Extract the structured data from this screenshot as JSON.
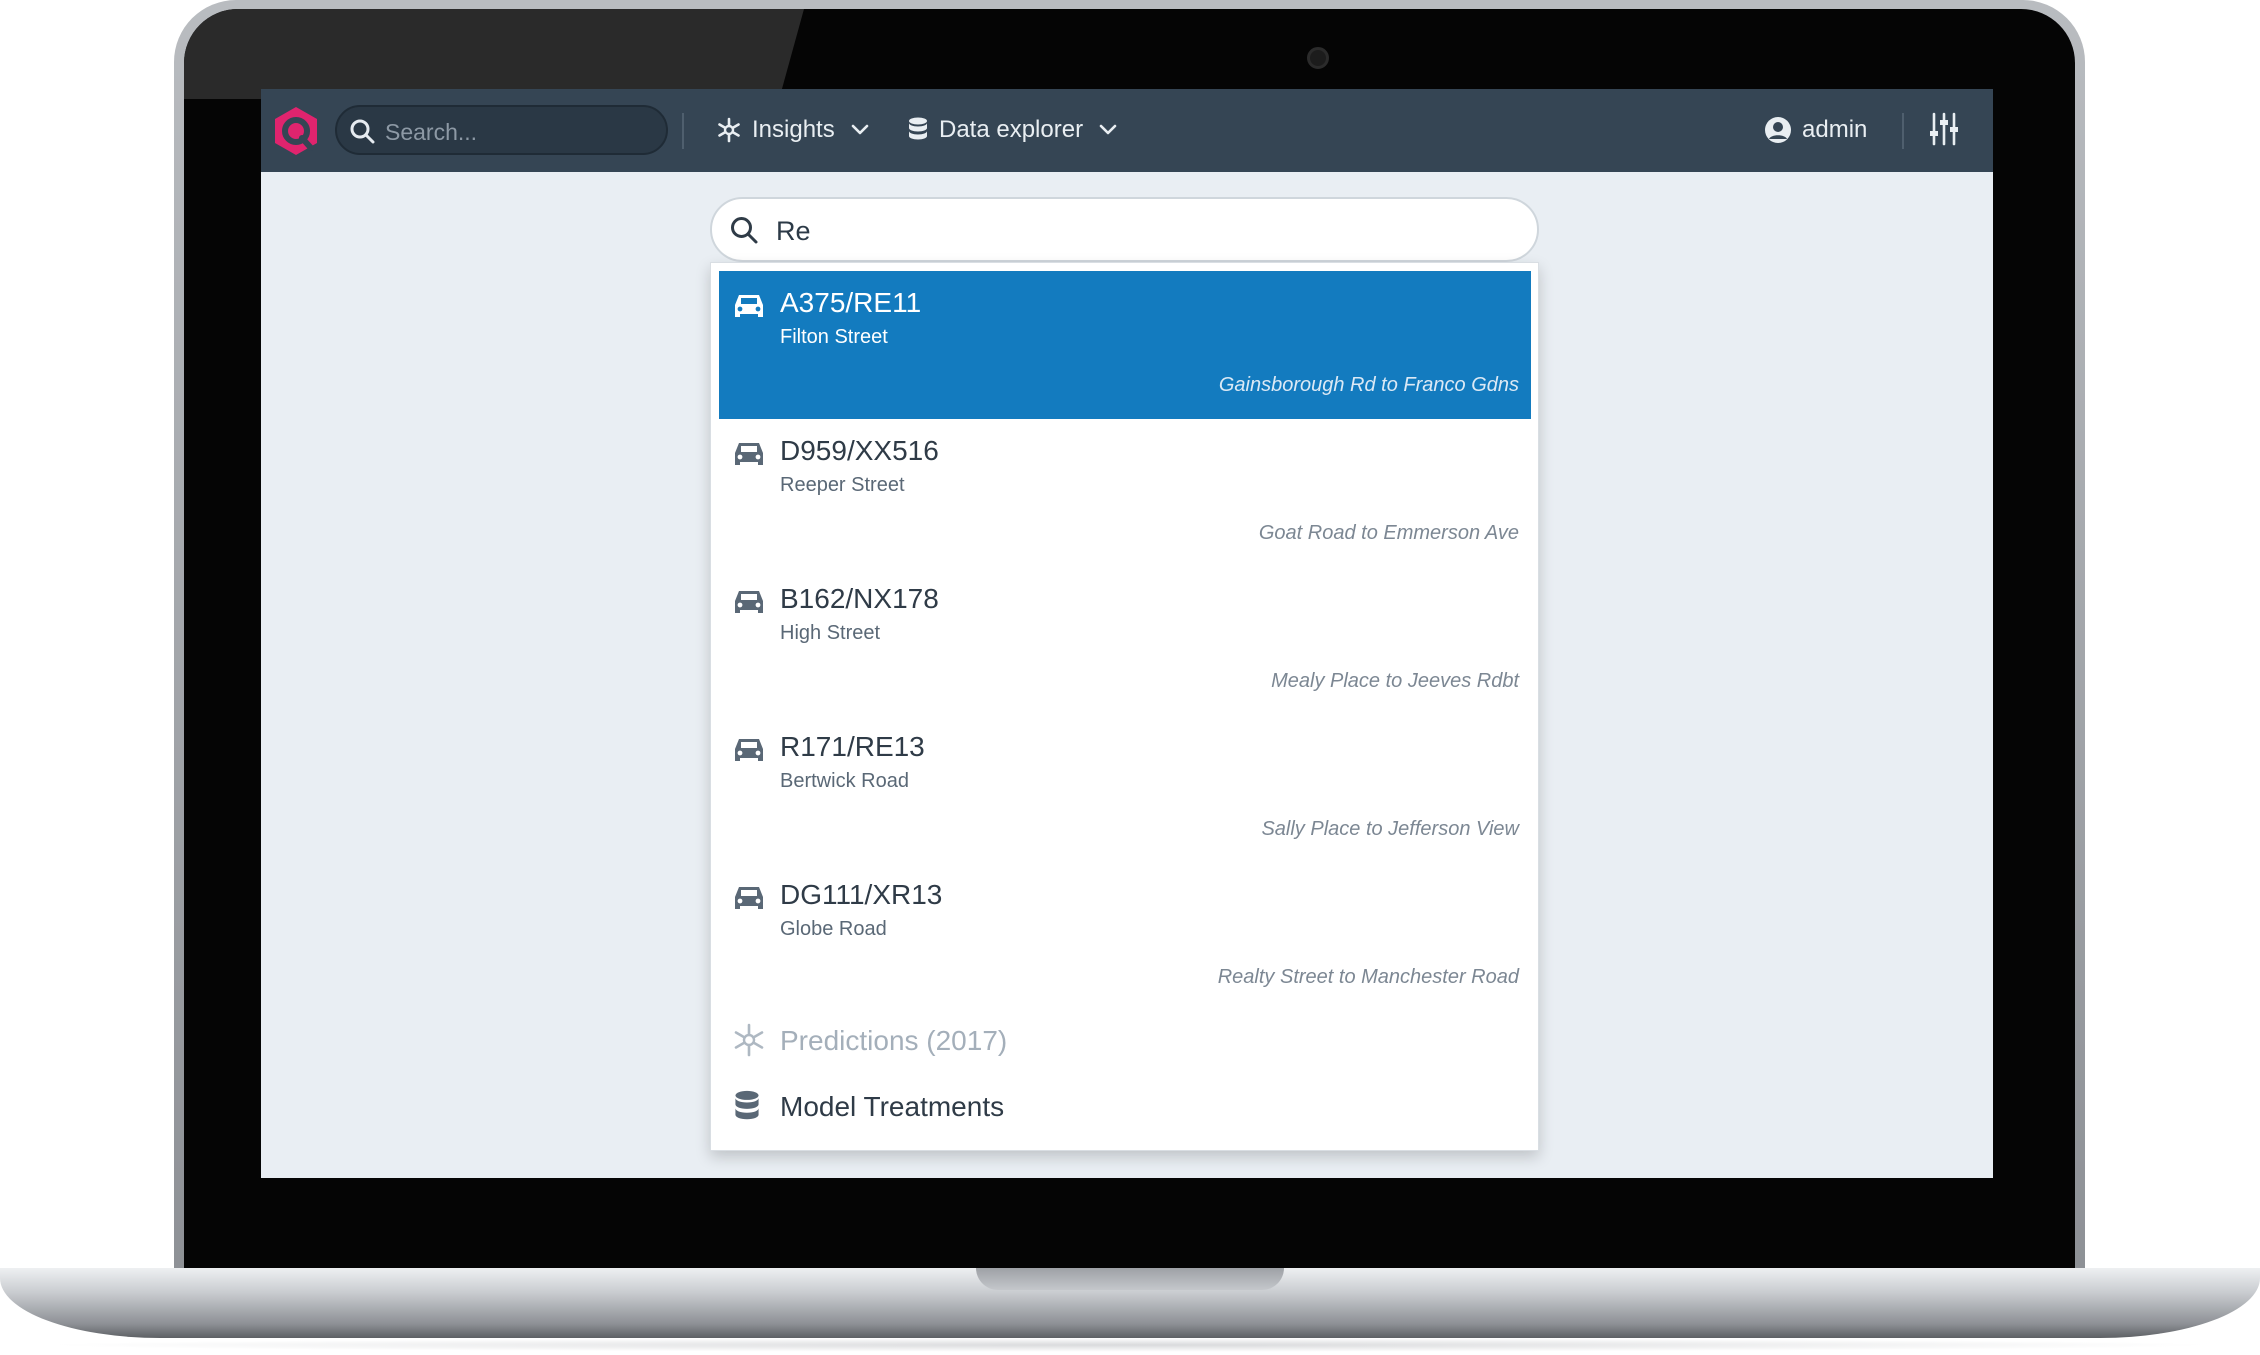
{
  "topbar": {
    "search_placeholder": "Search...",
    "nav": [
      {
        "label": "Insights",
        "icon": "asterisk-icon"
      },
      {
        "label": "Data explorer",
        "icon": "database-icon"
      }
    ],
    "user": "admin"
  },
  "search": {
    "value": "Re"
  },
  "results": [
    {
      "code": "A375/RE11",
      "street": "Filton Street",
      "range": "Gainsborough Rd to Franco Gdns",
      "active": true
    },
    {
      "code": "D959/XX516",
      "street": "Reeper Street",
      "range": "Goat Road to Emmerson Ave"
    },
    {
      "code": "B162/NX178",
      "street": "High Street",
      "range": "Mealy Place to Jeeves Rdbt"
    },
    {
      "code": "R171/RE13",
      "street": "Bertwick Road",
      "range": "Sally Place to Jefferson View"
    },
    {
      "code": "DG111/XR13",
      "street": "Globe Road",
      "range": "Realty Street to Manchester Road"
    }
  ],
  "extras": [
    {
      "label": "Predictions (2017)",
      "icon": "asterisk-icon"
    },
    {
      "label": "Model Treatments",
      "icon": "database-icon"
    }
  ],
  "colors": {
    "topbar": "#354554",
    "accent": "#137bbf",
    "brand": "#e0246e",
    "screen_bg": "#e9eef3"
  }
}
